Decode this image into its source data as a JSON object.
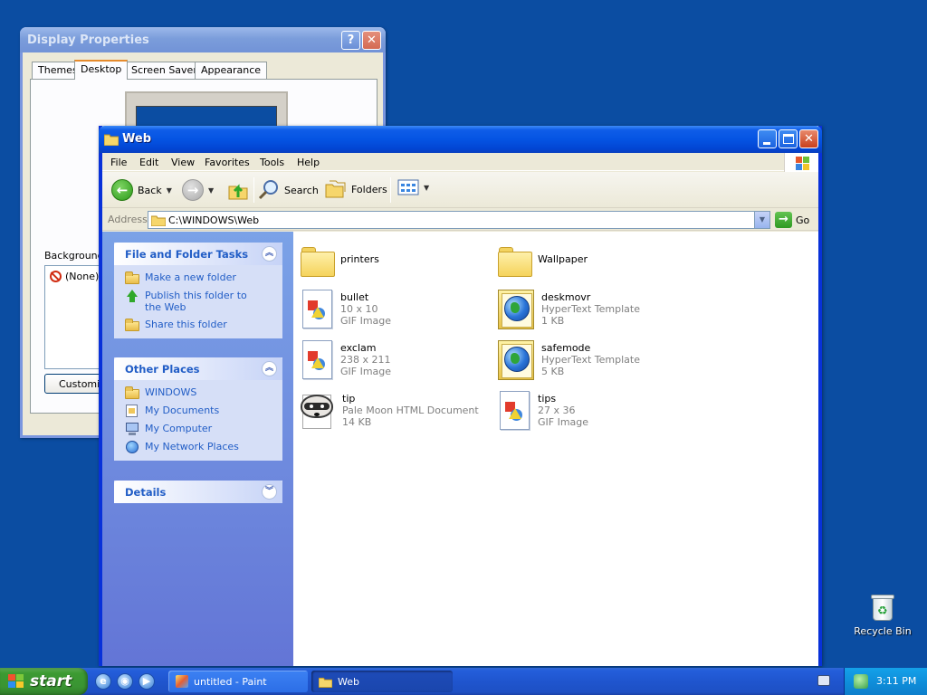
{
  "display_properties": {
    "title": "Display Properties",
    "tabs": [
      {
        "label": "Themes"
      },
      {
        "label": "Desktop"
      },
      {
        "label": "Screen Saver"
      },
      {
        "label": "Appearance"
      }
    ],
    "background_label": "Background:",
    "background_items": [
      "(None)"
    ],
    "customize_label": "Customize"
  },
  "explorer": {
    "title": "Web",
    "menu": [
      "File",
      "Edit",
      "View",
      "Favorites",
      "Tools",
      "Help"
    ],
    "toolbar": {
      "back": "Back",
      "search": "Search",
      "folders": "Folders"
    },
    "address": {
      "label": "Address",
      "value": "C:\\WINDOWS\\Web",
      "go": "Go"
    },
    "file_tasks": {
      "title": "File and Folder Tasks",
      "items": [
        "Make a new folder",
        "Publish this folder to the Web",
        "Share this folder"
      ]
    },
    "other_places": {
      "title": "Other Places",
      "items": [
        "WINDOWS",
        "My Documents",
        "My Computer",
        "My Network Places"
      ]
    },
    "details": {
      "title": "Details"
    },
    "files": [
      {
        "name": "printers",
        "type": "folder",
        "line1": "",
        "line2": ""
      },
      {
        "name": "Wallpaper",
        "type": "folder",
        "line1": "",
        "line2": ""
      },
      {
        "name": "bullet",
        "type": "gif",
        "line1": "10 x 10",
        "line2": "GIF Image"
      },
      {
        "name": "deskmovr",
        "type": "template",
        "line1": "HyperText Template",
        "line2": "1 KB"
      },
      {
        "name": "exclam",
        "type": "gif",
        "line1": "238 x 211",
        "line2": "GIF Image"
      },
      {
        "name": "safemode",
        "type": "template",
        "line1": "HyperText Template",
        "line2": "5 KB"
      },
      {
        "name": "tip",
        "type": "html",
        "line1": "Pale Moon HTML Document",
        "line2": "14 KB"
      },
      {
        "name": "tips",
        "type": "gif",
        "line1": "27 x 36",
        "line2": "GIF Image"
      }
    ]
  },
  "desktop": {
    "recycle_bin": "Recycle Bin"
  },
  "taskbar": {
    "start": "start",
    "tasks": [
      "untitled - Paint",
      "Web"
    ],
    "clock": "3:11 PM"
  },
  "colors": {
    "desktop": "#0b4da2",
    "titlebar_active": "#0554e3",
    "link_blue": "#215dc6",
    "start_green": "#3c9a32"
  }
}
